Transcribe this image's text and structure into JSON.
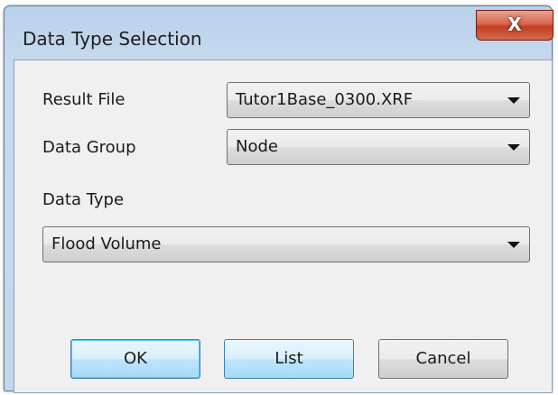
{
  "window": {
    "title": "Data Type Selection",
    "close_label": "X"
  },
  "form": {
    "result_file": {
      "label": "Result File",
      "value": "Tutor1Base_0300.XRF"
    },
    "data_group": {
      "label": "Data Group",
      "value": "Node"
    },
    "data_type": {
      "label": "Data Type",
      "value": "Flood Volume"
    }
  },
  "buttons": {
    "ok": "OK",
    "list": "List",
    "cancel": "Cancel"
  }
}
